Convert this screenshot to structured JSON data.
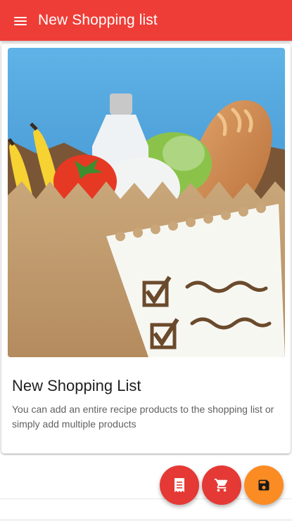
{
  "appbar": {
    "title": "New Shopping list",
    "menu_icon": "menu-icon"
  },
  "card": {
    "image": "grocery-bag-with-checklist",
    "title": "New Shopping List",
    "description": "You can add an entire recipe products to the shopping list or simply add multiple products"
  },
  "fabs": [
    {
      "icon": "receipt-icon",
      "color": "#e53935"
    },
    {
      "icon": "cart-icon",
      "color": "#e53935"
    },
    {
      "icon": "save-icon",
      "color": "#fb8c23"
    }
  ],
  "colors": {
    "primary": "#ee3d36",
    "accent": "#fb8c23"
  }
}
